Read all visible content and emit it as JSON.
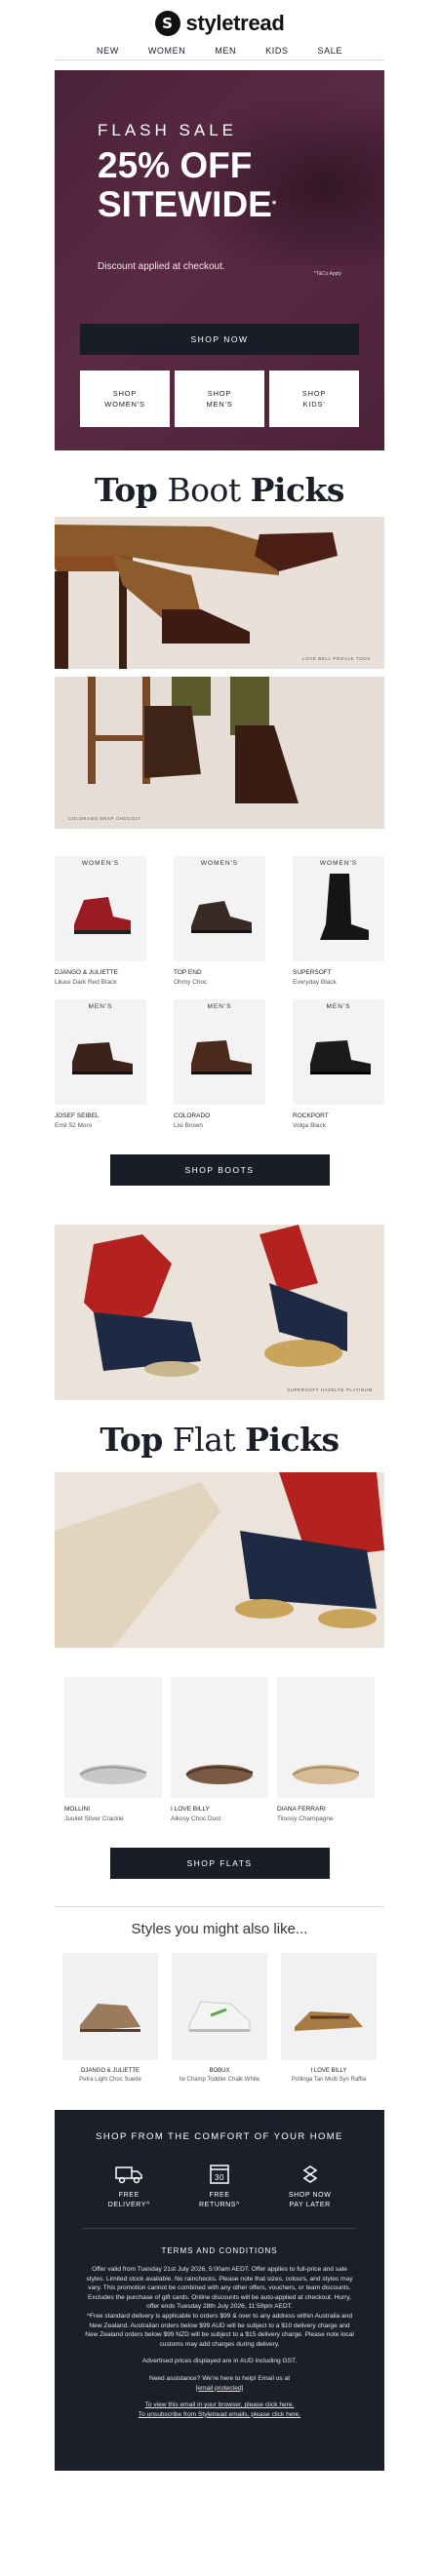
{
  "brand": {
    "name": "styletread",
    "mark": "S"
  },
  "nav": [
    "NEW",
    "WOMEN",
    "MEN",
    "KIDS",
    "SALE"
  ],
  "hero": {
    "kicker": "FLASH SALE",
    "line1": "25% OFF",
    "line2": "SITEWIDE",
    "sup": "*",
    "note": "Discount applied at checkout.",
    "tcs": "*T&Cs Apply",
    "cta": "SHOP NOW",
    "sub_buttons": [
      {
        "line1": "SHOP",
        "line2": "WOMEN'S"
      },
      {
        "line1": "SHOP",
        "line2": "MEN'S"
      },
      {
        "line1": "SHOP",
        "line2": "KIDS'"
      }
    ]
  },
  "boots": {
    "heading_bold": "Top",
    "heading_light": "Boot",
    "heading_end": "Picks",
    "photo1_caption": "LOVE BELL PROALE TOOS",
    "photo2_caption": "COLORADO SNAP CHOCOLT",
    "products": [
      {
        "tag": "WOMEN'S",
        "brand": "DJANGO & JULIETTE",
        "name": "Likasi Dark Red Black"
      },
      {
        "tag": "WOMEN'S",
        "brand": "TOP END",
        "name": "Ohmy Choc"
      },
      {
        "tag": "WOMEN'S",
        "brand": "SUPERSOFT",
        "name": "Everyday Black"
      },
      {
        "tag": "MEN'S",
        "brand": "JOSEF SEIBEL",
        "name": "Emil 52 Moro"
      },
      {
        "tag": "MEN'S",
        "brand": "COLORADO",
        "name": "Lisi Brown"
      },
      {
        "tag": "MEN'S",
        "brand": "ROCKPORT",
        "name": "Volga Black"
      }
    ],
    "cta": "SHOP BOOTS"
  },
  "flats": {
    "photo_caption": "SUPERSOFT HAZELTE PLATINUM",
    "heading_bold": "Top",
    "heading_light": "Flat",
    "heading_end": "Picks",
    "products": [
      {
        "brand": "MOLLINI",
        "name": "Juuliet Silver Crackle"
      },
      {
        "brand": "I LOVE BILLY",
        "name": "Alkosy Choc Dust"
      },
      {
        "brand": "DIANA FERRARI",
        "name": "Tiloosy Champagne"
      }
    ],
    "cta": "SHOP FLATS"
  },
  "also": {
    "title": "Styles you might also like...",
    "products": [
      {
        "brand": "DJANGO & JULIETTE",
        "name": "Petra Light Choc Suede"
      },
      {
        "brand": "BOBUX",
        "name": "Iw Champ Toddler Chalk White"
      },
      {
        "brand": "I LOVE BILLY",
        "name": "Pollinga Tan Multi Syn Raffia"
      }
    ]
  },
  "footer": {
    "title": "SHOP FROM THE COMFORT OF YOUR HOME",
    "perks": [
      {
        "icon": "truck-icon",
        "line1": "FREE",
        "line2": "DELIVERY^"
      },
      {
        "icon": "calendar-30-icon",
        "line1": "FREE",
        "line2": "RETURNS^",
        "badge": "30"
      },
      {
        "icon": "afterpay-icon",
        "line1": "SHOP NOW",
        "line2": "PAY LATER"
      }
    ],
    "tc_title": "TERMS AND CONDITIONS",
    "tc_body": "Offer valid from Tuesday 21st July 2026, 5:00am AEDT. Offer applies to full-price and sale styles. Limited stock available. No rainchecks. Please note that sizes, colours, and styles may vary. This promotion cannot be combined with any other offers, vouchers, or team discounts. Excludes the purchase of gift cards. Online discounts will be auto-applied at checkout. Hurry, offer ends Tuesday 28th July 2026, 11:59pm AEDT.",
    "tc_body2": "^Free standard delivery is applicable to orders $99 & over to any address within Australia and New Zealand. Australian orders below $99 AUD will be subject to a $10 delivery charge and New Zealand orders below $99 NZD will be subject to a $15 delivery charge. Please note local customs may add charges during delivery.",
    "currency_note": "Advertised prices displayed are in AUD including GST.",
    "help": "Need assistance? We're here to help! Email us at",
    "email": "[email protected]",
    "view_browser": "To view this email in your browser, please click here.",
    "unsubscribe": "To unsubscribe from Styletread emails, please click here."
  }
}
